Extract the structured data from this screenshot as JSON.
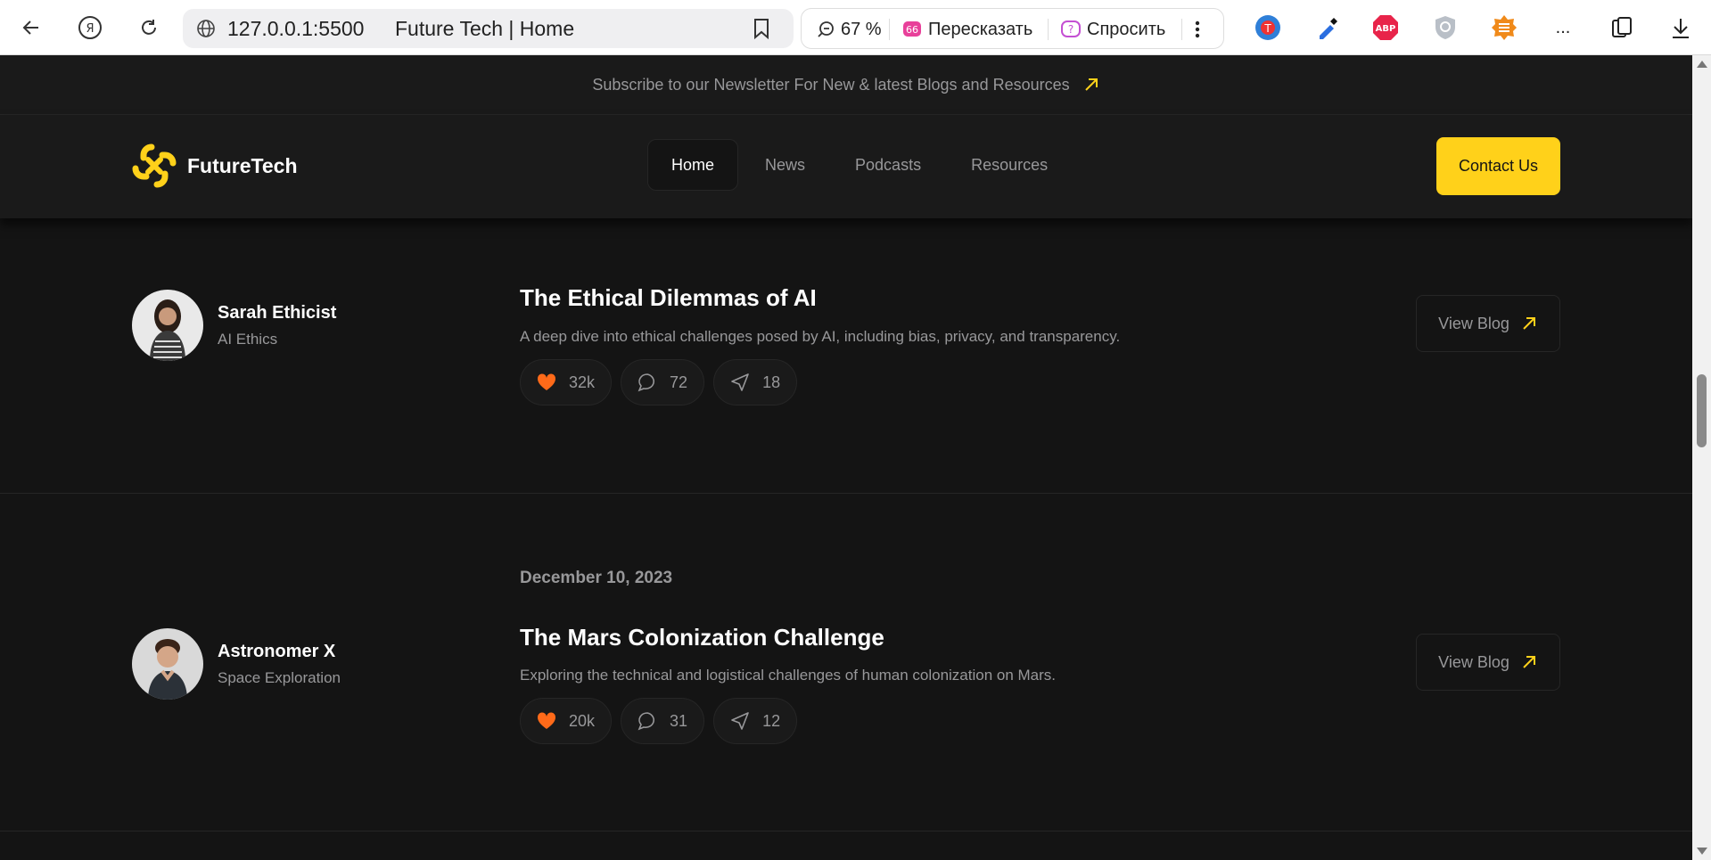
{
  "browser": {
    "url": "127.0.0.1:5500",
    "tab_title": "Future Tech | Home",
    "zoom": "67 %",
    "retell_label": "Пересказать",
    "ask_label": "Спросить",
    "more_label": "..."
  },
  "newsletter": {
    "text": "Subscribe to our Newsletter For New & latest Blogs and Resources"
  },
  "header": {
    "logo_text": "FutureTech",
    "nav": [
      {
        "label": "Home",
        "active": true
      },
      {
        "label": "News",
        "active": false
      },
      {
        "label": "Podcasts",
        "active": false
      },
      {
        "label": "Resources",
        "active": false
      }
    ],
    "contact_label": "Contact Us"
  },
  "posts": [
    {
      "author": "Sarah Ethicist",
      "category": "AI Ethics",
      "date": "",
      "title": "The Ethical Dilemmas of AI",
      "description": "A deep dive into ethical challenges posed by AI, including bias, privacy, and transparency.",
      "likes": "32k",
      "comments": "72",
      "shares": "18",
      "button_label": "View Blog"
    },
    {
      "author": "Astronomer X",
      "category": "Space Exploration",
      "date": "December 10, 2023",
      "title": "The Mars Colonization Challenge",
      "description": "Exploring the technical and logistical challenges of human colonization on Mars.",
      "likes": "20k",
      "comments": "31",
      "shares": "12",
      "button_label": "View Blog"
    }
  ],
  "colors": {
    "accent": "#ffd11a",
    "heart": "#ff6a19",
    "background": "#141414",
    "muted": "#98989a"
  }
}
